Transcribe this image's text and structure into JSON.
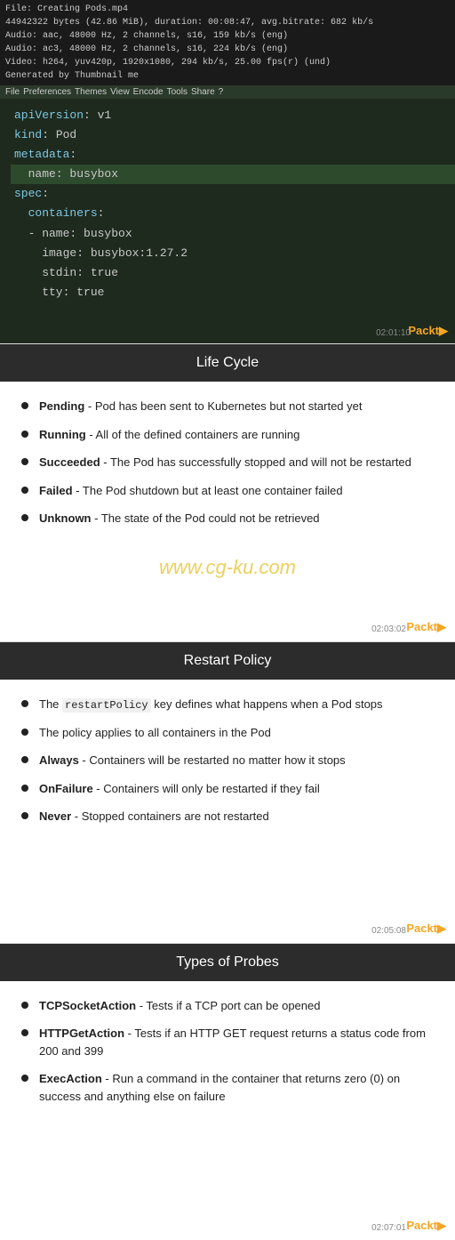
{
  "video": {
    "meta_lines": [
      "File: Creating Pods.mp4",
      "  44942322 bytes (42.86 MiB), duration: 00:08:47, avg.bitrate: 682 kb/s",
      "  Audio: aac, 48000 Hz, 2 channels, s16, 159 kb/s (eng)",
      "  Audio: ac3, 48000 Hz, 2 channels, s16, 224 kb/s (eng)",
      "  Video: h264, yuv420p, 1920x1080, 294 kb/s, 25.00 fps(r) (und)",
      "Generated by Thumbnail me"
    ],
    "toolbar_items": [
      "File",
      "Preferences",
      "Themes",
      "View",
      "Encode",
      "Tools",
      "Share",
      "?"
    ],
    "code_lines": [
      {
        "text": "apiVersion: v1",
        "highlight": false,
        "indent": 0
      },
      {
        "text": "kind: Pod",
        "highlight": false,
        "indent": 0
      },
      {
        "text": "metadata:",
        "highlight": false,
        "indent": 0
      },
      {
        "text": "  name: busybox",
        "highlight": true,
        "indent": 2
      },
      {
        "text": "spec:",
        "highlight": false,
        "indent": 0
      },
      {
        "text": "  containers:",
        "highlight": false,
        "indent": 2
      },
      {
        "text": "  - name: busybox",
        "highlight": false,
        "indent": 4
      },
      {
        "text": "    image: busybox:1.27.2",
        "highlight": false,
        "indent": 4
      },
      {
        "text": "    stdin: true",
        "highlight": false,
        "indent": 4
      },
      {
        "text": "    tty: true",
        "highlight": false,
        "indent": 4
      }
    ],
    "timestamp": "02:01:10",
    "badge": "Packt▶"
  },
  "lifecycle": {
    "header": "Life Cycle",
    "bullets": [
      {
        "term": "Pending",
        "text": " - Pod has been sent to Kubernetes but not started yet"
      },
      {
        "term": "Running",
        "text": " - All of the defined containers are running"
      },
      {
        "term": "Succeeded",
        "text": " - The Pod has successfully stopped and will not be restarted"
      },
      {
        "term": "Failed",
        "text": " - The Pod shutdown but at least one container failed"
      },
      {
        "term": "Unknown",
        "text": " - The state of the Pod could not be retrieved"
      }
    ],
    "watermark": "www.cg-ku.com",
    "timestamp": "02:03:02",
    "badge": "Packt▶"
  },
  "restart": {
    "header": "Restart Policy",
    "bullets": [
      {
        "term": "",
        "text": "The restartPolicy key defines what happens when a Pod stops",
        "has_code": true,
        "code_word": "restartPolicy"
      },
      {
        "term": "",
        "text": "The policy applies to all containers in the Pod",
        "has_code": false
      },
      {
        "term": "Always",
        "text": " - Containers will be restarted no matter how it stops"
      },
      {
        "term": "OnFailure",
        "text": " - Containers will only be restarted if they fail"
      },
      {
        "term": "Never",
        "text": " - Stopped containers are not restarted"
      }
    ],
    "timestamp": "02:05:08",
    "badge": "Packt▶"
  },
  "probes": {
    "header": "Types of Probes",
    "bullets": [
      {
        "term": "TCPSocketAction",
        "text": " - Tests if a TCP port can be opened"
      },
      {
        "term": "HTTPGetAction",
        "text": " - Tests if an HTTP GET request returns a status code from 200 and 399"
      },
      {
        "term": "ExecAction",
        "text": " - Run a command in the container that returns zero (0) on success and anything else on failure"
      }
    ],
    "timestamp": "02:07:01",
    "badge": "Packt▶"
  }
}
